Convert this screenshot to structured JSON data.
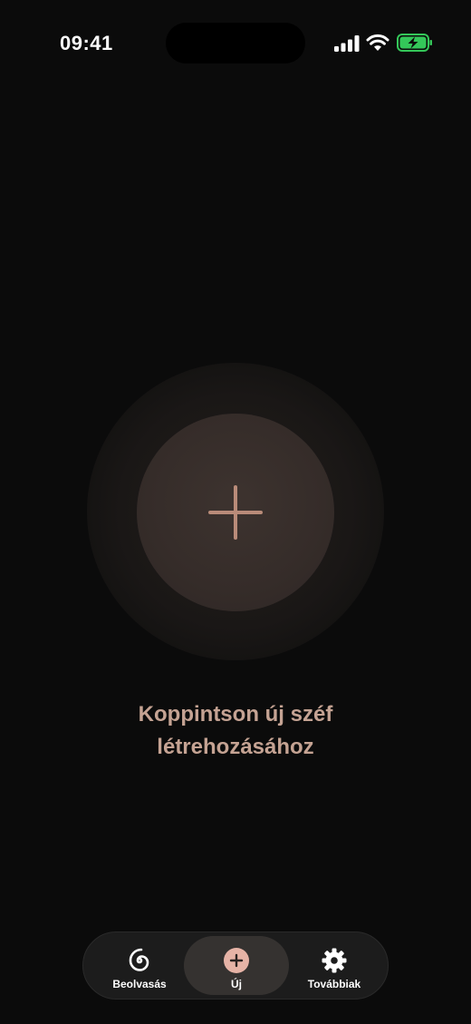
{
  "status_bar": {
    "time": "09:41",
    "icons": [
      "cellular-signal-icon",
      "wifi-icon",
      "battery-charging-icon"
    ]
  },
  "main": {
    "create_button_icon": "plus-icon",
    "prompt_line1": "Koppintson új széf",
    "prompt_line2": "létrehozásához"
  },
  "tabbar": {
    "tabs": [
      {
        "label": "Beolvasás",
        "icon": "spiral-scan-icon",
        "selected": false
      },
      {
        "label": "Új",
        "icon": "plus-circle-icon",
        "selected": true
      },
      {
        "label": "Továbbiak",
        "icon": "gear-icon",
        "selected": false
      }
    ]
  },
  "colors": {
    "background": "#0b0b0b",
    "accent": "#c5a393",
    "accent_light": "#e6b3a6",
    "battery_green": "#34c759"
  }
}
